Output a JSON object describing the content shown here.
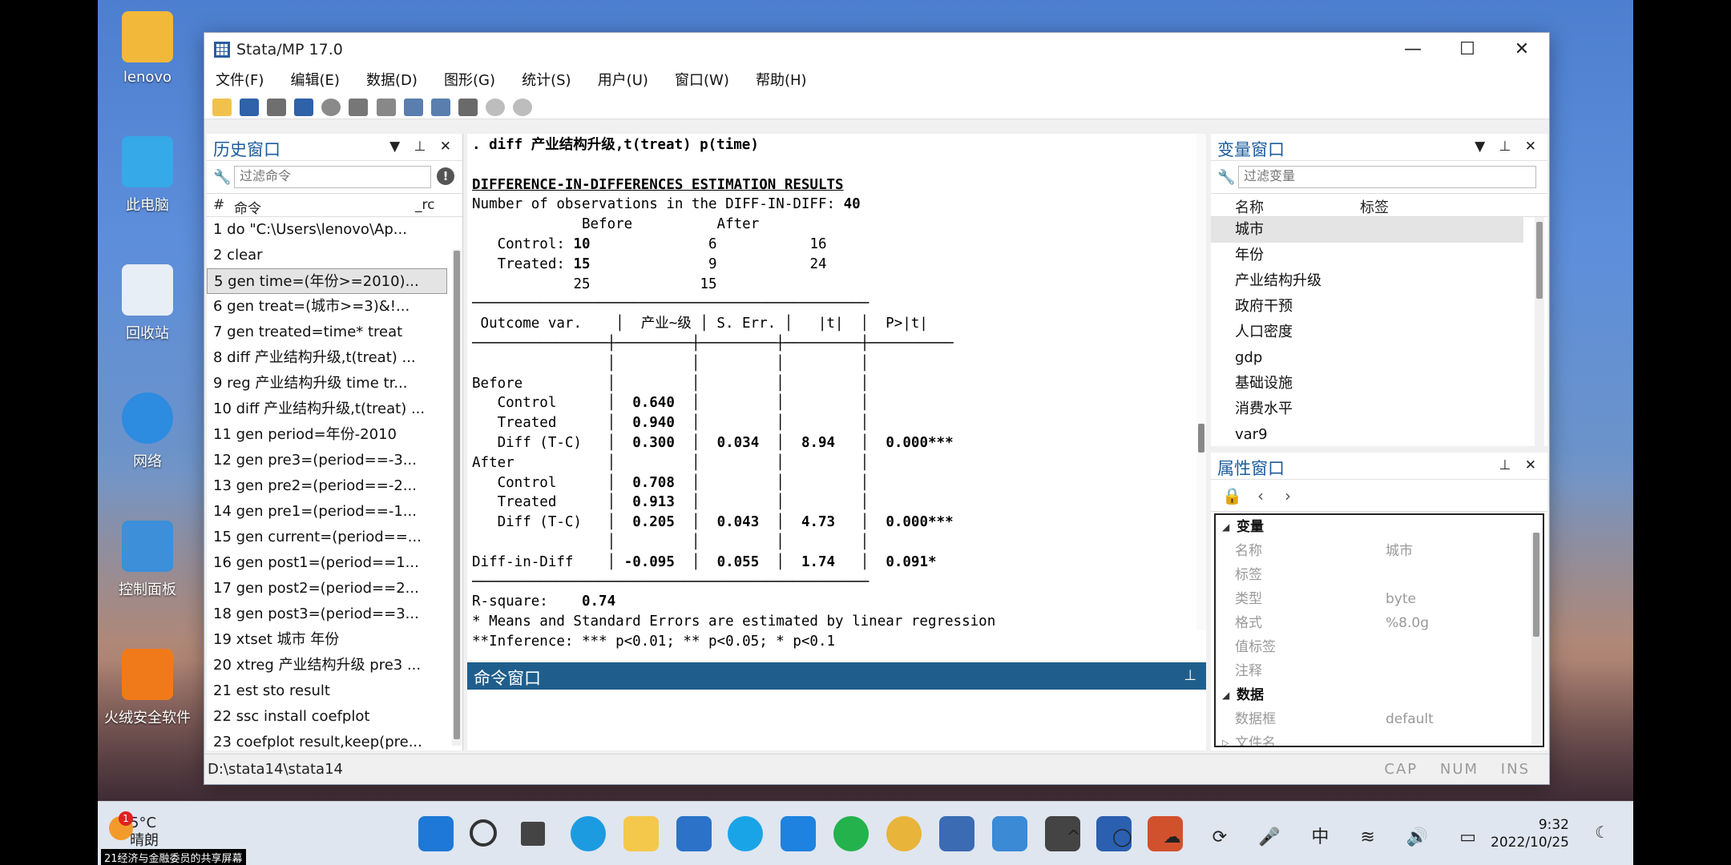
{
  "desktop": {
    "icons": [
      "lenovo",
      "此电脑",
      "回收站",
      "网络",
      "控制面板",
      "火绒安全软件"
    ]
  },
  "window": {
    "title": "Stata/MP 17.0",
    "controls": {
      "minimize": "—",
      "maximize": "☐",
      "close": "✕"
    }
  },
  "menu": [
    "文件(F)",
    "编辑(E)",
    "数据(D)",
    "图形(G)",
    "统计(S)",
    "用户(U)",
    "窗口(W)",
    "帮助(H)"
  ],
  "history": {
    "title": "历史窗口",
    "filter_placeholder": "过滤命令",
    "col_num": "#",
    "col_cmd": "命令",
    "col_rc": "_rc",
    "rows": [
      "1  do \"C:\\Users\\lenovo\\Ap...",
      "2  clear",
      "5  gen time=(年份>=2010)...",
      "6  gen treat=(城市>=3)&!...",
      "7  gen treated=time* treat",
      "8  diff 产业结构升级,t(treat) ...",
      "9  reg 产业结构升级 time tr...",
      "10 diff 产业结构升级,t(treat) ...",
      "11 gen period=年份-2010",
      "12 gen pre3=(period==-3...",
      "13 gen pre2=(period==-2...",
      "14 gen pre1=(period==-1...",
      "15 gen current=(period==...",
      "16 gen post1=(period==1...",
      "17 gen post2=(period==2...",
      "18 gen post3=(period==3...",
      "19 xtset 城市 年份",
      "20 xtreg 产业结构升级 pre3 ...",
      "21 est sto result",
      "22 ssc install coefplot",
      "23 coefplot result,keep(pre..."
    ]
  },
  "results": {
    "command": ". diff 产业结构升级,t(treat) p(time)",
    "heading": "DIFFERENCE-IN-DIFFERENCES ESTIMATION RESULTS",
    "obs_label": "Number of observations in the DIFF-IN-DIFF:",
    "obs_value": "40",
    "counts": {
      "header": [
        "Before",
        "After"
      ],
      "control": {
        "label": "Control:",
        "before": "10",
        "after": "6",
        "total": "16"
      },
      "treated": {
        "label": "Treated:",
        "before": "15",
        "after": "9",
        "total": "24"
      },
      "totals": {
        "before": "25",
        "after": "15"
      }
    },
    "table_header": {
      "outcome": "Outcome var.",
      "coef": "产业~级",
      "se": "S. Err.",
      "t": "|t|",
      "p": "P>|t|"
    },
    "before_label": "Before",
    "after_label": "After",
    "before": {
      "control": {
        "label": "Control",
        "coef": "0.640"
      },
      "treated": {
        "label": "Treated",
        "coef": "0.940"
      },
      "diff": {
        "label": "Diff (T-C)",
        "coef": "0.300",
        "se": "0.034",
        "t": "8.94",
        "p": "0.000***"
      }
    },
    "after": {
      "control": {
        "label": "Control",
        "coef": "0.708"
      },
      "treated": {
        "label": "Treated",
        "coef": "0.913"
      },
      "diff": {
        "label": "Diff (T-C)",
        "coef": "0.205",
        "se": "0.043",
        "t": "4.73",
        "p": "0.000***"
      }
    },
    "did": {
      "label": "Diff-in-Diff",
      "coef": "-0.095",
      "se": "0.055",
      "t": "1.74",
      "p": "0.091*"
    },
    "rsq_label": "R-square:",
    "rsq_value": "0.74",
    "note1": "* Means and Standard Errors are estimated by linear regression",
    "note2": "**Inference: *** p<0.01; ** p<0.05; * p<0.1"
  },
  "command_window": {
    "title": "命令窗口"
  },
  "variables": {
    "title": "变量窗口",
    "filter_placeholder": "过滤变量",
    "col_name": "名称",
    "col_label": "标签",
    "rows": [
      "城市",
      "年份",
      "产业结构升级",
      "政府干预",
      "人口密度",
      "gdp",
      "基础设施",
      "消费水平",
      "var9"
    ]
  },
  "properties": {
    "title": "属性窗口",
    "section_var": "变量",
    "section_data": "数据",
    "rows_var": [
      {
        "k": "名称",
        "v": "城市"
      },
      {
        "k": "标签",
        "v": ""
      },
      {
        "k": "类型",
        "v": "byte"
      },
      {
        "k": "格式",
        "v": "%8.0g"
      },
      {
        "k": "值标签",
        "v": ""
      },
      {
        "k": "注释",
        "v": ""
      }
    ],
    "rows_data": [
      {
        "k": "数据框",
        "v": "default"
      },
      {
        "k": "文件名",
        "v": ""
      }
    ]
  },
  "status": {
    "path": "D:\\stata14\\stata14",
    "cap": "CAP",
    "num": "NUM",
    "ins": "INS"
  },
  "taskbar": {
    "weather_temp": "5°C",
    "weather_desc": "晴朗",
    "badge": "1",
    "time": "9:32",
    "date": "2022/10/25",
    "ime": "中",
    "share_label": "21经济与金融委员的共享屏幕"
  }
}
